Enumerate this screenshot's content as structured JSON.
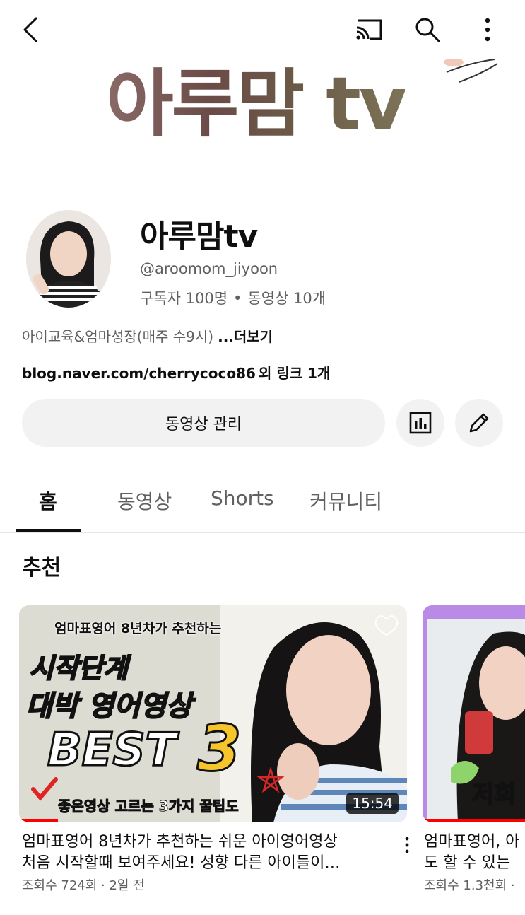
{
  "banner": {
    "title": "아루맘 tv"
  },
  "channel": {
    "name": "아루맘tv",
    "handle": "@aroomom_jiyoon",
    "subscribers": "구독자 100명",
    "separator": "•",
    "videos": "동영상 10개",
    "description": "아이교육&엄마성장(매주 수9시)",
    "more": "...더보기",
    "link": "blog.naver.com/cherrycoco86",
    "link_extra": "외 링크 1개"
  },
  "actions": {
    "manage_label": "동영상 관리"
  },
  "tabs": [
    {
      "label": "홈",
      "active": true
    },
    {
      "label": "동영상",
      "active": false
    },
    {
      "label": "Shorts",
      "active": false
    },
    {
      "label": "커뮤니티",
      "active": false
    }
  ],
  "section": {
    "title": "추천"
  },
  "videos": [
    {
      "thumb_lines": {
        "top": "엄마표영어 8년차가 추천하는",
        "line1": "시작단계",
        "line2": "대박 영어영상",
        "best": "BEST",
        "number": "3",
        "bottom": "좋은영상 고르는 3가지 꿀팁도"
      },
      "duration": "15:54",
      "progress": 0.1,
      "title_line1": "엄마표영어 8년차가 추천하는 쉬운 아이영어영상",
      "title_line2": "처음 시작할때 보여주세요!  성향 다른 아이들이…",
      "meta": "조회수 724회 · 2일 전"
    },
    {
      "thumb_lines": {
        "overlay": "저희"
      },
      "title_line1": "엄마표영어, 아",
      "title_line2": "도 할 수 있는",
      "meta": "조회수 1.3천회 ·"
    }
  ],
  "colors": {
    "accent": "#ff0000",
    "button_bg": "#f2f2f2",
    "secondary_text": "#606060"
  },
  "icons": {
    "back": "chevron-left-icon",
    "cast": "cast-icon",
    "search": "search-icon",
    "more": "more-vertical-icon",
    "analytics": "bar-chart-icon",
    "edit": "pencil-icon"
  }
}
